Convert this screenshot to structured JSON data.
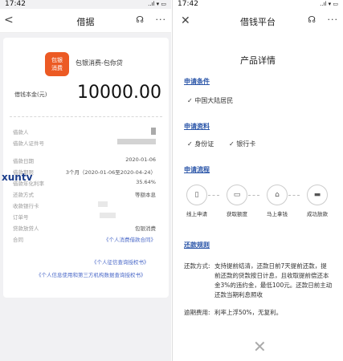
{
  "left": {
    "status": {
      "time": "17:42",
      "signal": "..ıl ▾ ▭"
    },
    "nav": {
      "back": "<",
      "title": "借据",
      "service": "☊",
      "more": "···"
    },
    "product": {
      "logo_line1": "包银",
      "logo_line2": "消费",
      "name": "包银消费-包你贷"
    },
    "amount_label": "借钱本金(元)",
    "amount": "10000.00",
    "rows": [
      {
        "k": "借款人",
        "v": ""
      },
      {
        "k": "借款人证件号",
        "v": ""
      },
      {
        "k": "借款日期",
        "v": "2020-01-06"
      },
      {
        "k": "借款期限",
        "v": "3个月（2020-01-06至2020-04-24）"
      },
      {
        "k": "借款年化利率",
        "v": "35.64%"
      },
      {
        "k": "还款方式",
        "v": "等额本息"
      },
      {
        "k": "收款银行卡",
        "v": ""
      },
      {
        "k": "订单号",
        "v": ""
      },
      {
        "k": "贷款放贷人",
        "v": "包银消费"
      },
      {
        "k": "合同",
        "v": "《个人消费借款合同》"
      }
    ],
    "links": [
      "《个人征信查询授权书》",
      "《个人信息使用和第三方机构数据查询授权书》"
    ],
    "watermark": "xuntv"
  },
  "right": {
    "status": {
      "time": "17:42",
      "signal": "..ıl ▾ ▭"
    },
    "nav": {
      "back": "✕",
      "title": "借钱平台",
      "service": "☊",
      "more": "···"
    },
    "page_title": "产品详情",
    "sections": {
      "conditions": {
        "title": "申请条件",
        "items": [
          "✓ 中国大陆居民"
        ]
      },
      "materials": {
        "title": "申请资料",
        "items": [
          "✓ 身份证",
          "✓ 银行卡"
        ]
      },
      "process": {
        "title": "申请流程",
        "steps": [
          {
            "icon": "phone-icon",
            "glyph": "▯",
            "label": "线上申请"
          },
          {
            "icon": "id-card-icon",
            "glyph": "▭",
            "label": "获取额度"
          },
          {
            "icon": "bank-icon",
            "glyph": "⌂",
            "label": "马上拿钱"
          },
          {
            "icon": "card-icon",
            "glyph": "▬",
            "label": "成功放款"
          }
        ]
      },
      "repayment": {
        "title": "还款规则",
        "method_label": "还款方式:",
        "method_text": "支持提前结清，还款日前7天提前还款，提前还款的贷款按日计息，且收取提前偿还本金3%的违约金，最低100元。还款日前主动还款当期利息照收",
        "overdue_label": "逾期费用:",
        "overdue_text": "利率上浮50%，无复利。"
      }
    },
    "close": "✕"
  }
}
